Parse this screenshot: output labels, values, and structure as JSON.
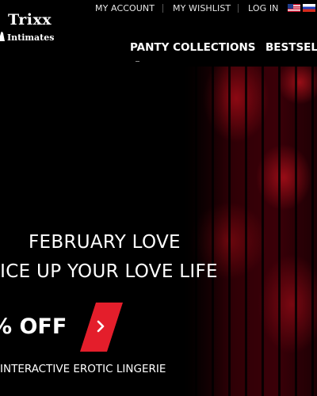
{
  "header": {
    "links": {
      "account": "MY ACCOUNT",
      "wishlist": "MY WISHLIST",
      "login": "LOG IN"
    },
    "flags": [
      "flag-us-icon",
      "flag-ru-icon"
    ]
  },
  "logo": {
    "name": "Trixx",
    "sub": "Intimates"
  },
  "nav": {
    "items": [
      "PANTY COLLECTIONS",
      "BESTSELL"
    ]
  },
  "hero": {
    "title": "FEBRUARY LOVE",
    "subtitle": "PICE UP YOUR LOVE LIFE",
    "offer": "% OFF",
    "tagline": "INTERACTIVE EROTIC LINGERIE",
    "cta_icon": "chevron-right-icon"
  },
  "colors": {
    "background": "#000000",
    "accent": "#e41e2b",
    "text": "#ffffff"
  }
}
